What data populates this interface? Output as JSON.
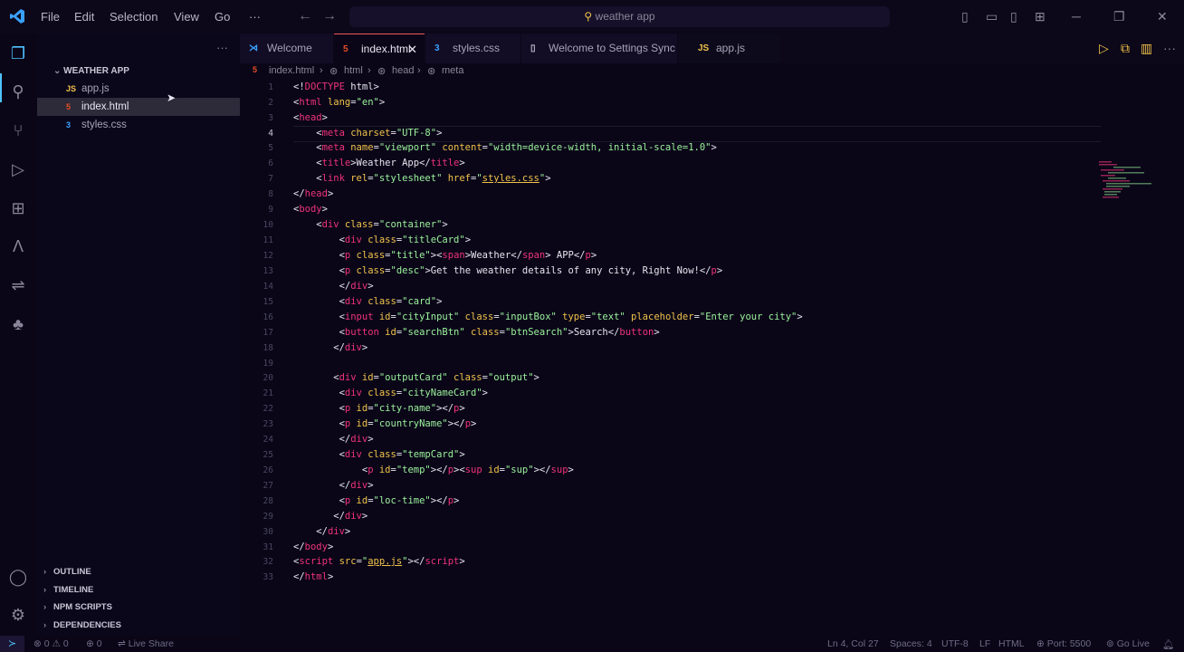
{
  "titlebar": {
    "menus": [
      "File",
      "Edit",
      "Selection",
      "View",
      "Go",
      "···"
    ],
    "search_text": "weather app"
  },
  "explorer": {
    "folder": "WEATHER APP",
    "files": [
      {
        "icon": "JS",
        "name": "app.js"
      },
      {
        "icon": "5",
        "name": "index.html"
      },
      {
        "icon": "3",
        "name": "styles.css"
      }
    ],
    "sections": [
      "OUTLINE",
      "TIMELINE",
      "NPM SCRIPTS",
      "DEPENDENCIES"
    ]
  },
  "tabs": [
    {
      "icon": "vscode-icon",
      "label": "Welcome"
    },
    {
      "icon": "5",
      "label": "index.html"
    },
    {
      "icon": "3",
      "label": "styles.css"
    },
    {
      "icon": "file-icon",
      "label": "Welcome to Settings Sync"
    },
    {
      "icon": "JS",
      "label": "app.js"
    }
  ],
  "breadcrumb": [
    "index.html",
    "html",
    "head",
    "meta"
  ],
  "code": {
    "line_numbers": [
      "1",
      "2",
      "3",
      "4",
      "5",
      "6",
      "7",
      "8",
      "9",
      "10",
      "11",
      "12",
      "13",
      "14",
      "15",
      "16",
      "17",
      "18",
      "19",
      "20",
      "21",
      "22",
      "23",
      "24",
      "25",
      "26",
      "27",
      "28",
      "29",
      "30",
      "31",
      "32",
      "33"
    ],
    "current_line": "4"
  },
  "status": {
    "errors": "0",
    "warnings": "0",
    "ports": "0",
    "live_share": "Live Share",
    "cursor": "Ln 4, Col 27",
    "spaces": "Spaces: 4",
    "encoding": "UTF-8",
    "eol": "LF",
    "language": "HTML",
    "port": "Port: 5500",
    "go_live": "Go Live"
  },
  "colors": {
    "accent": "#4fc3ff",
    "tag": "#f0337a",
    "attr": "#f0c24a",
    "string": "#9cf39c"
  }
}
